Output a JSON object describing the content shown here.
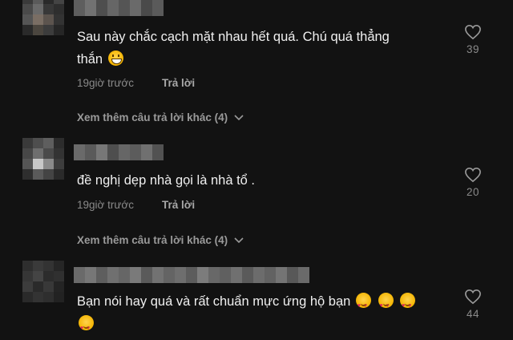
{
  "comments": [
    {
      "text_line1": "Sau này chắc cạch mặt nhau hết quá. Chú quá thẳng",
      "text_line2": "thắn",
      "emoji": "grinning-face",
      "time": "19giờ trước",
      "reply_label": "Trả lời",
      "more_replies": "Xem thêm câu trả lời khác (4)",
      "likes": "39"
    },
    {
      "text": "đề nghị dẹp nhà gọi là nhà tổ .",
      "time": "19giờ trước",
      "reply_label": "Trả lời",
      "more_replies": "Xem thêm câu trả lời khác (4)",
      "likes": "20"
    },
    {
      "text": "Bạn nói hay quá và rất chuẩn mực ứng hộ bạn",
      "emoji": "smiling-face-with-hearts",
      "emoji_count": 4,
      "likes": "44"
    }
  ],
  "icons": {
    "like": "heart-outline-icon",
    "expand": "chevron-down-icon"
  },
  "colors": {
    "background": "#121212",
    "text": "#f0f0f0",
    "muted": "#8a8a8a"
  }
}
